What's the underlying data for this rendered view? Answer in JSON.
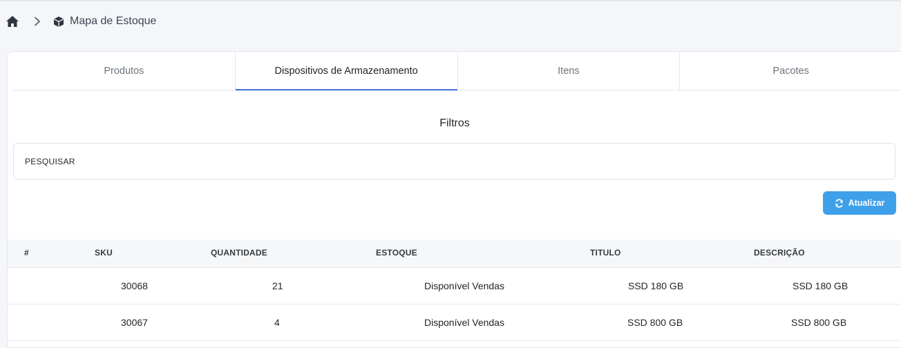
{
  "breadcrumb": {
    "home_icon": "home-icon",
    "separator_icon": "chevron-right-icon",
    "page_icon": "box-icon",
    "title": "Mapa de Estoque"
  },
  "tabs": [
    {
      "label": "Produtos",
      "active": false
    },
    {
      "label": "Dispositivos de Armazenamento",
      "active": true
    },
    {
      "label": "Itens",
      "active": false
    },
    {
      "label": "Pacotes",
      "active": false
    }
  ],
  "filters": {
    "title": "Filtros",
    "search_placeholder": "PESQUISAR",
    "search_value": ""
  },
  "refresh_button": {
    "label": "Atualizar",
    "icon": "refresh-icon",
    "color": "#3fa0ea"
  },
  "table": {
    "headers": [
      "#",
      "SKU",
      "QUANTIDADE",
      "ESTOQUE",
      "TITULO",
      "DESCRIÇÃO"
    ],
    "rows": [
      {
        "index": "",
        "sku": "30068",
        "quantidade": "21",
        "estoque": "Disponível Vendas",
        "titulo": "SSD 180 GB",
        "descricao": "SSD 180 GB"
      },
      {
        "index": "",
        "sku": "30067",
        "quantidade": "4",
        "estoque": "Disponível Vendas",
        "titulo": "SSD 800 GB",
        "descricao": "SSD 800 GB"
      }
    ]
  },
  "colors": {
    "accent": "#3b6fd6",
    "button": "#3fa0ea",
    "background": "#f4f6f9"
  }
}
